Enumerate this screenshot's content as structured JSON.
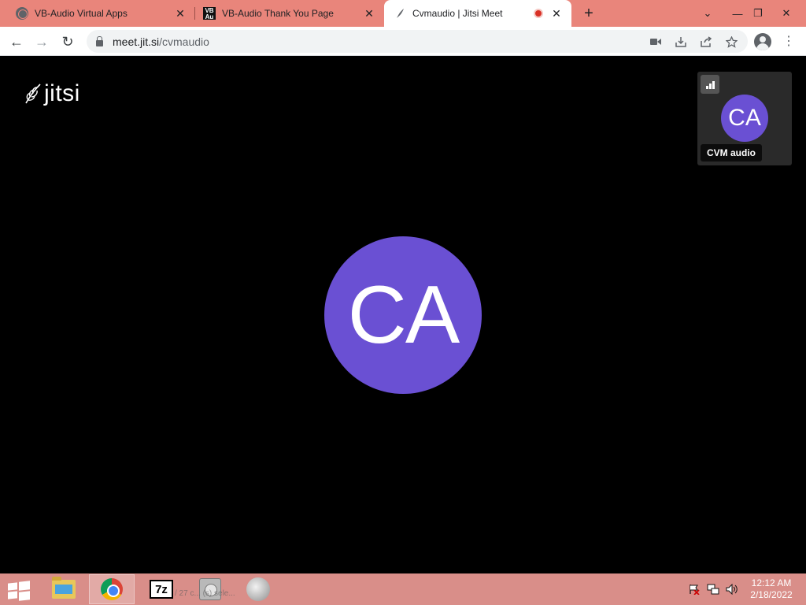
{
  "browser": {
    "tabs": [
      {
        "title": "VB-Audio Virtual Apps",
        "icon": "globe-icon",
        "close": "✕"
      },
      {
        "title": "VB-Audio Thank You Page",
        "icon": "vb-audio-icon",
        "close": "✕"
      },
      {
        "title": "Cvmaudio | Jitsi Meet",
        "icon": "jitsi-icon",
        "close": "✕",
        "recording": true
      }
    ],
    "new_tab": "+",
    "controls": {
      "tab_search": "⌄",
      "minimize": "—",
      "restore": "❐",
      "close": "✕"
    },
    "address": {
      "host": "meet.jit.si",
      "path": "/cvmaudio"
    },
    "nav": {
      "back": "←",
      "forward": "→",
      "reload": "↻"
    },
    "omnibox_icons": [
      "camera-icon",
      "install-icon",
      "share-icon",
      "bookmark-star-icon"
    ],
    "menu": "⋮"
  },
  "meeting": {
    "logo_text": "jitsi",
    "main_avatar_initials": "CA",
    "avatar_color": "#6a50d3",
    "thumbnail": {
      "initials": "CA",
      "name": "CVM audio"
    }
  },
  "taskbar": {
    "apps": [
      "file-explorer-icon",
      "chrome-icon",
      "7zip-icon",
      "disk-utility-icon",
      "speaker-app-icon"
    ],
    "app_label_7zip": "7z",
    "ghost_text": "/ 27 c... (s) sele...",
    "clock": {
      "time": "12:12 AM",
      "date": "2/18/2022"
    },
    "tray": [
      "action-center-flag-icon",
      "network-icon",
      "volume-icon"
    ]
  },
  "colors": {
    "tabstrip": "#e9857b",
    "taskbar": "#d98e89",
    "background": "#000000"
  }
}
